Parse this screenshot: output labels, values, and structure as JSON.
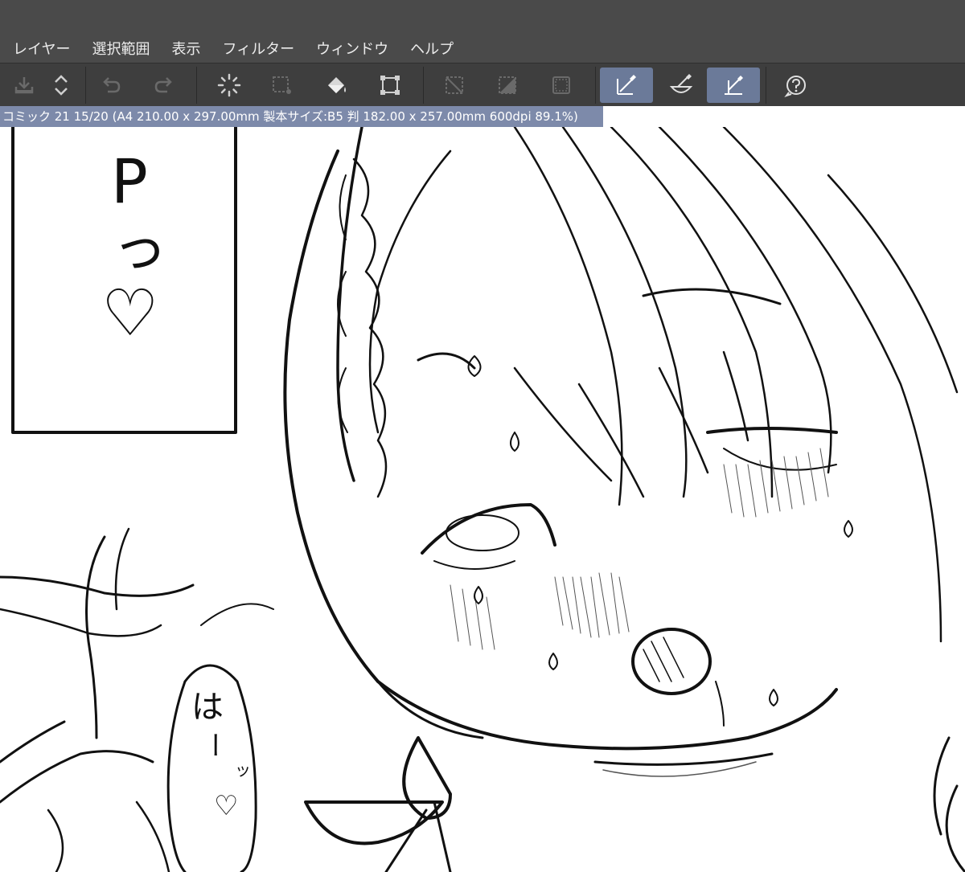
{
  "menu": {
    "items": [
      {
        "label": "レイヤー"
      },
      {
        "label": "選択範囲"
      },
      {
        "label": "表示"
      },
      {
        "label": "フィルター"
      },
      {
        "label": "ウィンドウ"
      },
      {
        "label": "ヘルプ"
      }
    ]
  },
  "toolbar": {
    "tools": [
      {
        "name": "export-icon",
        "active": false
      },
      {
        "name": "layer-order-icon",
        "active": false
      },
      {
        "name": "undo-icon",
        "active": false
      },
      {
        "name": "redo-icon",
        "active": false
      },
      {
        "name": "loading-spinner-icon",
        "active": false
      },
      {
        "name": "select-all-icon",
        "active": false
      },
      {
        "name": "fill-bucket-icon",
        "active": false
      },
      {
        "name": "transform-icon",
        "active": false
      },
      {
        "name": "deselect-icon",
        "active": false
      },
      {
        "name": "invert-selection-icon",
        "active": false
      },
      {
        "name": "show-selection-icon",
        "active": false
      },
      {
        "name": "snap-ruler-icon",
        "active": true
      },
      {
        "name": "snap-special-ruler-icon",
        "active": false
      },
      {
        "name": "snap-grid-icon",
        "active": true
      },
      {
        "name": "help-icon",
        "active": false
      }
    ]
  },
  "document": {
    "info": "コミック 21 15/20 (A4 210.00 x 297.00mm 製本サイズ:B5 判 182.00 x 257.00mm 600dpi 89.1%)"
  },
  "artwork": {
    "panel_text_1": "P",
    "panel_text_2": "っ",
    "panel_heart": "♡",
    "bubble_text": "は",
    "bubble_dash": "ー",
    "bubble_small": "ッ",
    "bubble_heart": "♡"
  },
  "colors": {
    "menubar": "#4a4a4a",
    "toolbar": "#3e3e3e",
    "active_tool": "#6b7a99",
    "docbar": "#7d8aaa"
  }
}
